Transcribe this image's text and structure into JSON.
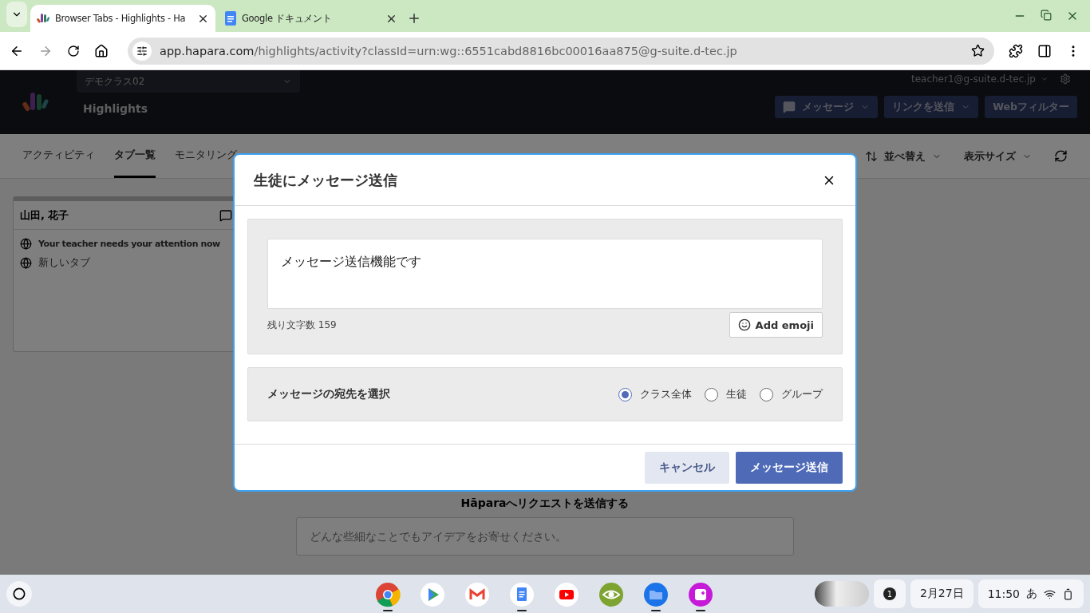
{
  "browser": {
    "tabs": [
      {
        "title": "Browser Tabs - Highlights - Ha",
        "selected": true,
        "kind": "hapara"
      },
      {
        "title": "Google ドキュメント",
        "selected": false,
        "kind": "docs"
      }
    ],
    "url_host": "app.hapara.com",
    "url_path": "/highlights/activity?classId=urn:wg::6551cabd8816bc00016aa875@g-suite.d-tec.jp"
  },
  "app": {
    "class_select": "デモクラス02",
    "product": "Highlights",
    "user": "teacher1@g-suite.d-tec.jp",
    "header_buttons": [
      {
        "label": "メッセージ",
        "kind": "message"
      },
      {
        "label": "リンクを送信",
        "kind": "dropdown"
      },
      {
        "label": "Webフィルター",
        "kind": "plain"
      }
    ],
    "nav_tabs": [
      {
        "label": "アクティビティ",
        "selected": false
      },
      {
        "label": "タブ一覧",
        "selected": true
      },
      {
        "label": "モニタリング",
        "selected": false
      }
    ],
    "toolbar": [
      {
        "label": "並べ替え",
        "kind": "sort"
      },
      {
        "label": "表示サイズ",
        "kind": "size"
      }
    ],
    "student_card": {
      "name": "山田, 花子",
      "tabs": [
        {
          "title": "Your teacher needs your attention now",
          "active": true
        },
        {
          "title": "新しいタブ",
          "active": false
        }
      ]
    },
    "feedback": {
      "title": "Hāparaへリクエストを送信する",
      "placeholder": "どんな些細なことでもアイデアをお寄せください。"
    }
  },
  "dialog": {
    "title": "生徒にメッセージ送信",
    "message": "メッセージ送信機能です",
    "remaining": "残り文字数 159",
    "emoji_button": "Add emoji",
    "recipient_label": "メッセージの宛先を選択",
    "recipients": [
      {
        "label": "クラス全体",
        "selected": true
      },
      {
        "label": "生徒",
        "selected": false
      },
      {
        "label": "グループ",
        "selected": false
      }
    ],
    "cancel": "キャンセル",
    "send": "メッセージ送信"
  },
  "shelf": {
    "apps": [
      {
        "kind": "chrome",
        "open": true
      },
      {
        "kind": "play",
        "open": false
      },
      {
        "kind": "gmail",
        "open": false
      },
      {
        "kind": "docs",
        "open": true
      },
      {
        "kind": "youtube",
        "open": false
      },
      {
        "kind": "eye",
        "open": false
      },
      {
        "kind": "files",
        "open": true
      },
      {
        "kind": "sparkle",
        "open": true
      }
    ],
    "notifications": "1",
    "date": "2月27日",
    "time": "11:50",
    "ime": "あ"
  }
}
